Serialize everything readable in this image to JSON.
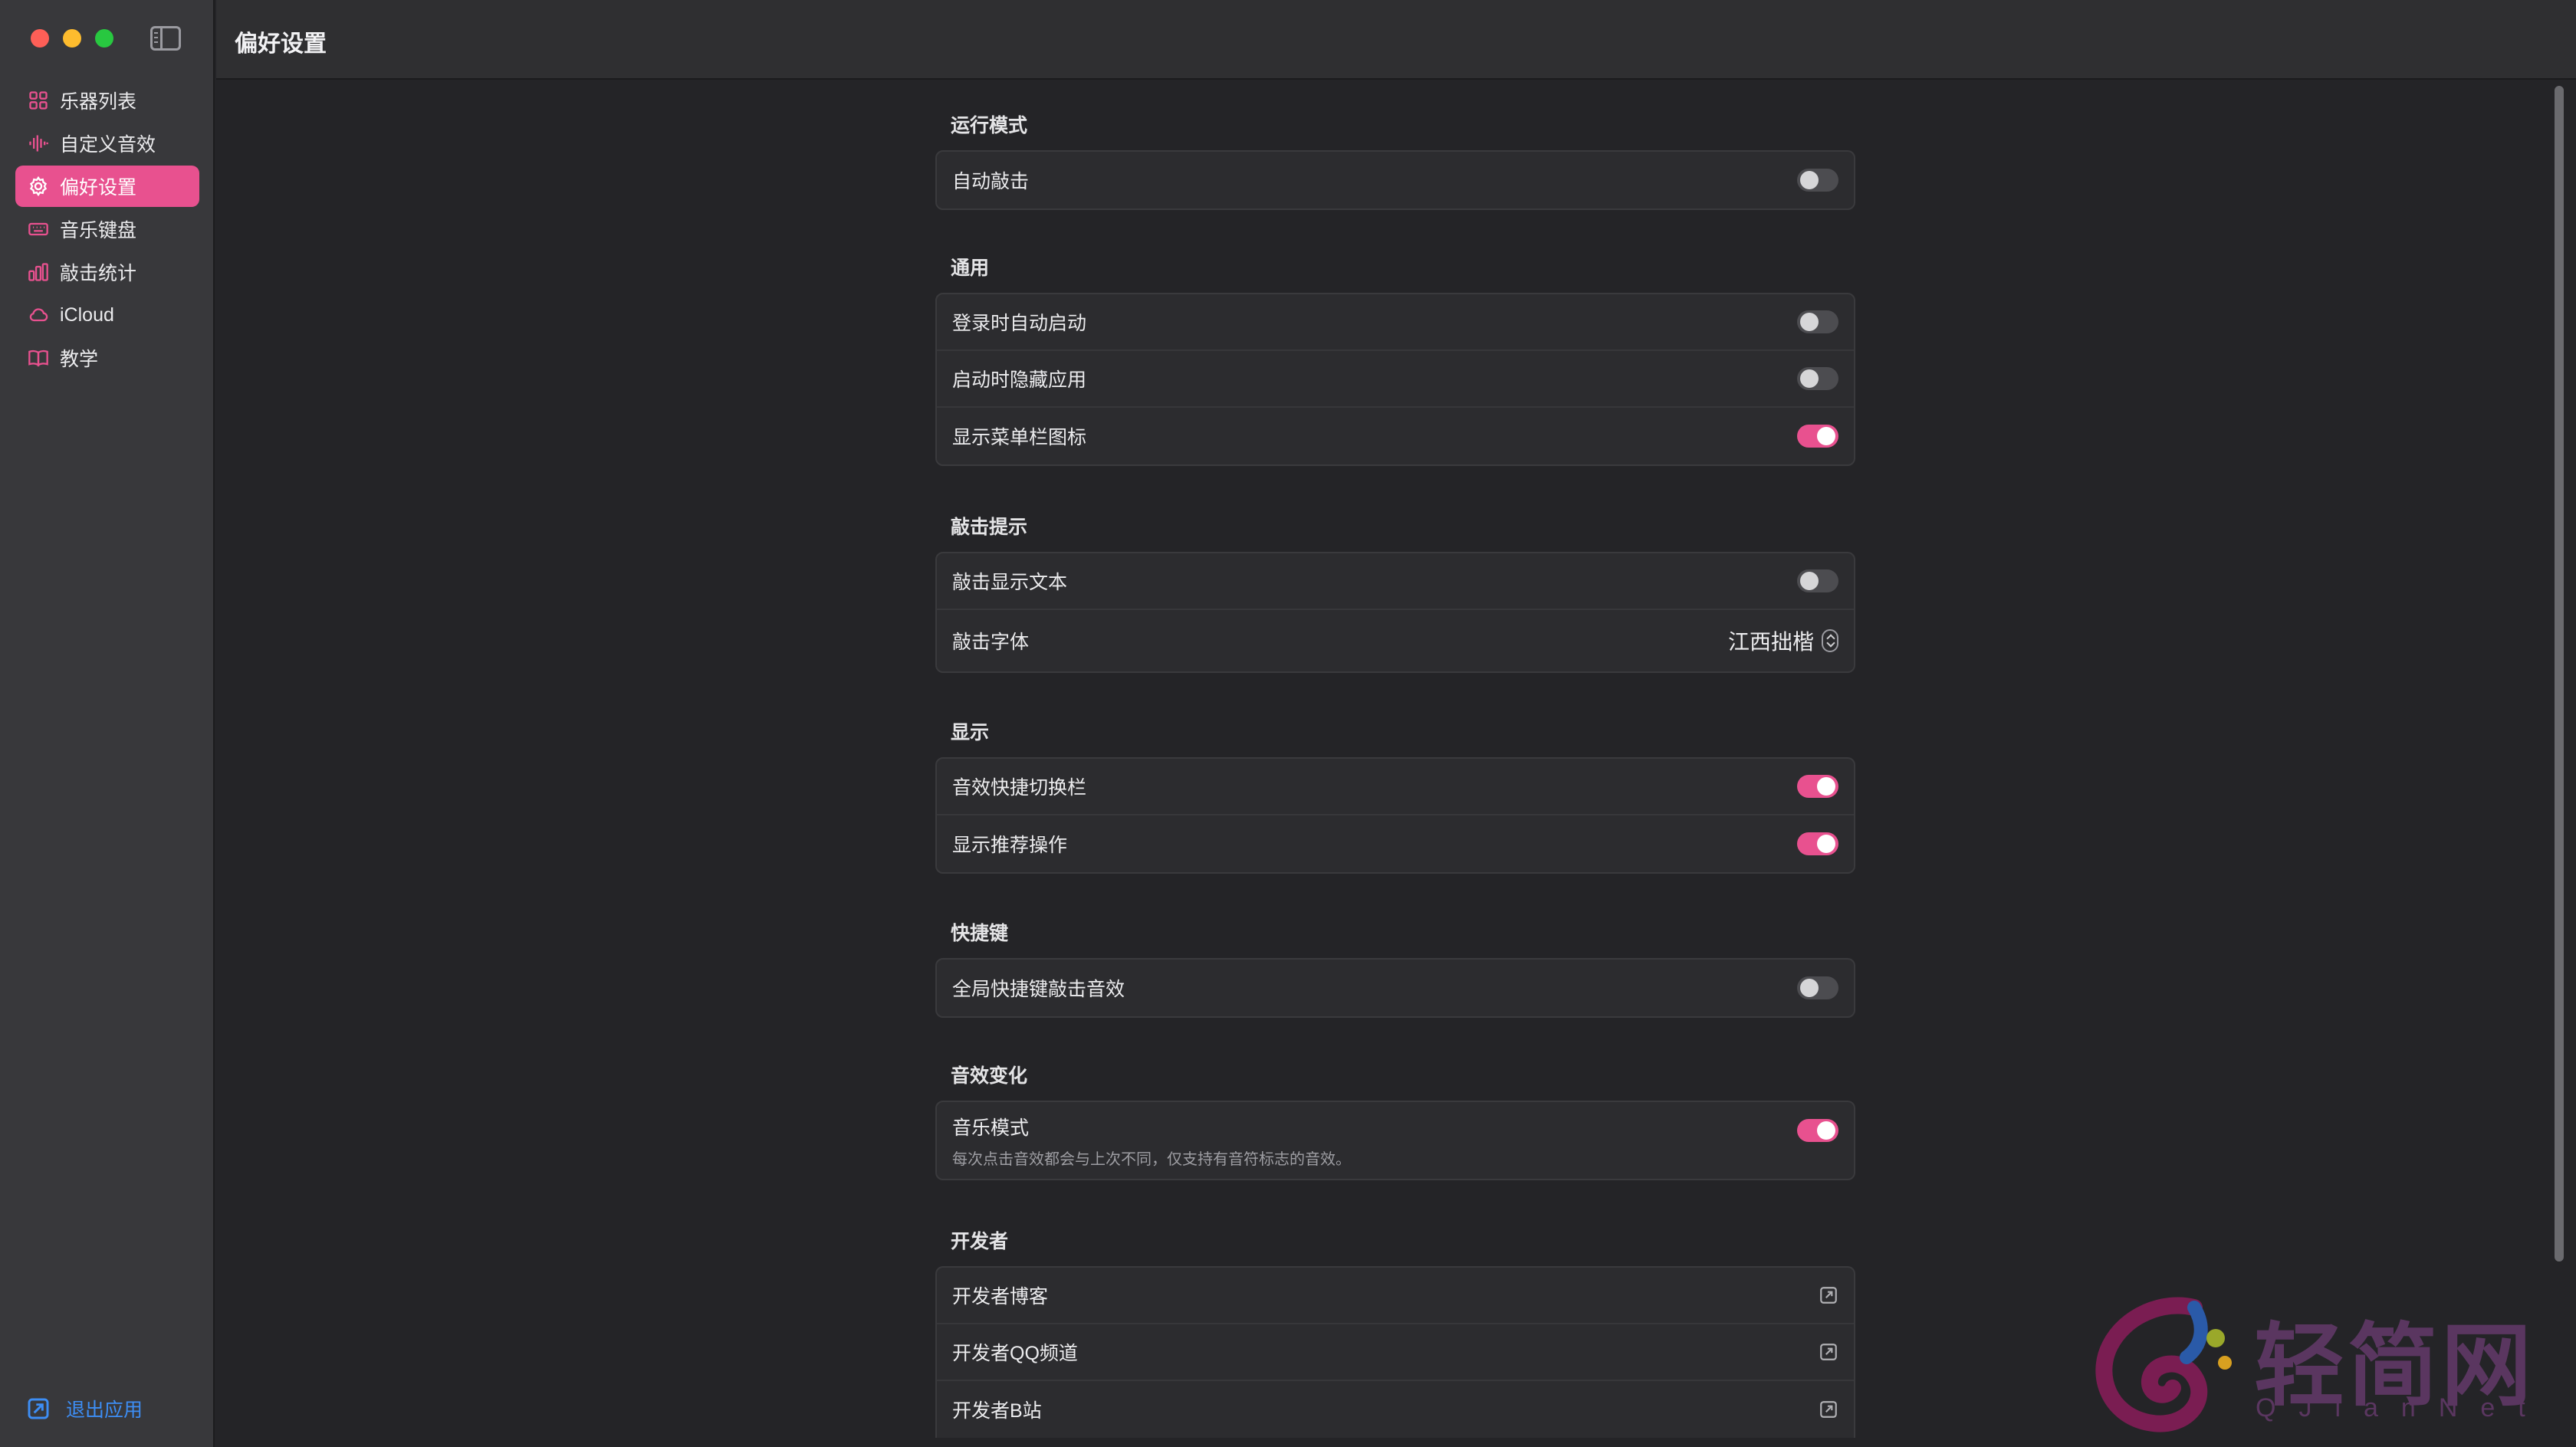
{
  "header": {
    "title": "偏好设置"
  },
  "sidebar": {
    "items": [
      {
        "label": "乐器列表",
        "icon": "grid-icon",
        "active": false
      },
      {
        "label": "自定义音效",
        "icon": "waveform-icon",
        "active": false
      },
      {
        "label": "偏好设置",
        "icon": "gear-icon",
        "active": true
      },
      {
        "label": "音乐键盘",
        "icon": "keyboard-icon",
        "active": false
      },
      {
        "label": "敲击统计",
        "icon": "bar-chart-icon",
        "active": false
      },
      {
        "label": "iCloud",
        "icon": "cloud-icon",
        "active": false
      },
      {
        "label": "教学",
        "icon": "book-icon",
        "active": false
      }
    ],
    "quit_label": "退出应用"
  },
  "sections": {
    "run_mode": {
      "title": "运行模式",
      "auto_tap": {
        "label": "自动敲击",
        "on": false
      }
    },
    "general": {
      "title": "通用",
      "launch_at_login": {
        "label": "登录时自动启动",
        "on": false
      },
      "hide_on_launch": {
        "label": "启动时隐藏应用",
        "on": false
      },
      "show_menubar_icon": {
        "label": "显示菜单栏图标",
        "on": true
      }
    },
    "tap_hint": {
      "title": "敲击提示",
      "show_text": {
        "label": "敲击显示文本",
        "on": false
      },
      "font": {
        "label": "敲击字体",
        "value": "江西拙楷"
      }
    },
    "display": {
      "title": "显示",
      "quick_switch_bar": {
        "label": "音效快捷切换栏",
        "on": true
      },
      "show_recommended": {
        "label": "显示推荐操作",
        "on": true
      }
    },
    "shortcuts": {
      "title": "快捷键",
      "global_shortcut": {
        "label": "全局快捷键敲击音效",
        "on": false
      }
    },
    "sound_variation": {
      "title": "音效变化",
      "music_mode": {
        "label": "音乐模式",
        "description": "每次点击音效都会与上次不同，仅支持有音符标志的音效。",
        "on": true
      }
    },
    "developer": {
      "title": "开发者",
      "blog": {
        "label": "开发者博客"
      },
      "qq_channel": {
        "label": "开发者QQ频道"
      },
      "bilibili": {
        "label": "开发者B站"
      }
    }
  },
  "watermark": {
    "text": "轻简网",
    "sub": "QJianNet"
  },
  "colors": {
    "accent": "#e8518f",
    "link": "#3d8ef5"
  }
}
